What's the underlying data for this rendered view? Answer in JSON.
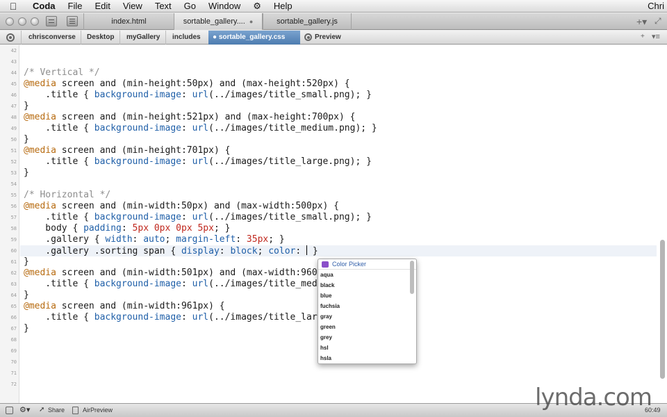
{
  "menubar": {
    "app": "Coda",
    "items": [
      "File",
      "Edit",
      "View",
      "Text",
      "Go",
      "Window",
      "Help"
    ],
    "user": "Chri"
  },
  "tabs": [
    {
      "label": "index.html"
    },
    {
      "label": "sortable_gallery....",
      "active": true
    },
    {
      "label": "sortable_gallery.js"
    }
  ],
  "pathbar": {
    "crumbs": [
      "chrisconverse",
      "Desktop",
      "myGallery",
      "includes"
    ],
    "file": "sortable_gallery.css",
    "preview": "Preview"
  },
  "editor": {
    "line_numbers": [
      "42",
      "43",
      "44",
      "45",
      "46",
      "47",
      "48",
      "49",
      "50",
      "51",
      "52",
      "53",
      "54",
      "55",
      "56",
      "57",
      "58",
      "59",
      "60",
      "61",
      "62",
      "63",
      "64",
      "65",
      "66",
      "67",
      "68",
      "69",
      "70",
      "71",
      "72"
    ],
    "current_line": "60",
    "lines": [
      "",
      "",
      "/* Vertical */",
      "@media screen and (min-height:50px) and (max-height:520px) {",
      "    .title { background-image: url(../images/title_small.png); }",
      "}",
      "@media screen and (min-height:521px) and (max-height:700px) {",
      "    .title { background-image: url(../images/title_medium.png); }",
      "}",
      "@media screen and (min-height:701px) {",
      "    .title { background-image: url(../images/title_large.png); }",
      "}",
      "",
      "/* Horizontal */",
      "@media screen and (min-width:50px) and (max-width:500px) {",
      "    .title { background-image: url(../images/title_small.png); }",
      "    body { padding: 5px 0px 0px 5px; }",
      "    .gallery { width: auto; margin-left: 35px; }",
      "    .gallery .sorting span { display: block; color: ",
      "}",
      "@media screen and (min-width:501px) and (max-width:960px) {",
      "    .title { background-image: url(../images/title_medium.png); }",
      "}",
      "@media screen and (min-width:961px) {",
      "    .title { background-image: url(../images/title_large.png); }",
      "}"
    ]
  },
  "color_picker": {
    "title": "Color Picker",
    "options": [
      "aqua",
      "black",
      "blue",
      "fuchsia",
      "gray",
      "green",
      "grey",
      "hsl",
      "hsla"
    ]
  },
  "statusbar": {
    "share": "Share",
    "airpreview": "AirPreview",
    "position": "60:49"
  },
  "watermark": "lynda.com",
  "colors": {
    "at_rule": "#b76b10",
    "property": "#1f5fa8",
    "number": "#c0281e",
    "comment": "#8d8d8d",
    "active_file": "#4d7cb0"
  }
}
